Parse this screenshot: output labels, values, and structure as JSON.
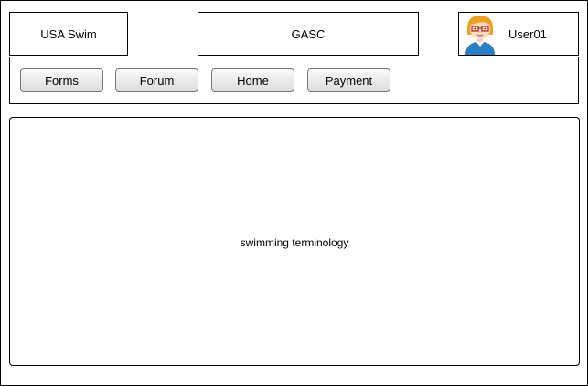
{
  "header": {
    "left_label": "USA Swim",
    "center_label": "GASC",
    "user_name": "User01",
    "avatar_icon": "user-avatar-icon"
  },
  "nav": {
    "items": [
      {
        "label": "Forms"
      },
      {
        "label": "Forum"
      },
      {
        "label": "Home"
      },
      {
        "label": "Payment"
      }
    ]
  },
  "main": {
    "text": "swimming terminology"
  },
  "colors": {
    "border": "#000000",
    "button_top": "#fafafa",
    "button_bottom": "#dcdcdc",
    "avatar_hair": "#f0a020",
    "avatar_shirt": "#2a7fc0"
  }
}
